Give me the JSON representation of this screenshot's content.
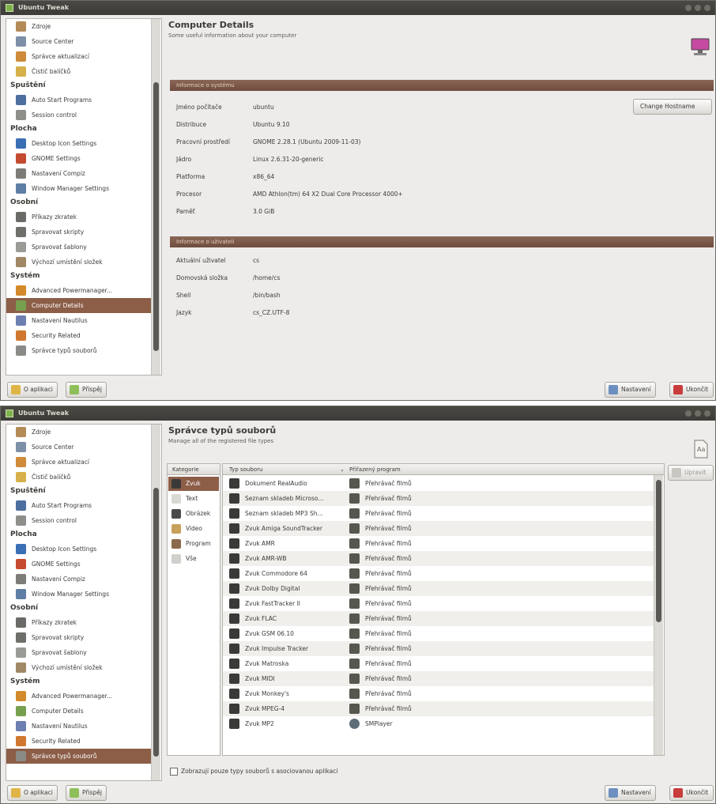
{
  "app_title": "Ubuntu Tweak",
  "colors": {
    "accent": "#8c5e48",
    "titlebar": "#3c3b37",
    "banner": "#7c5a4a",
    "window_bg": "#edeceb"
  },
  "sidebar": {
    "items": [
      {
        "label": "Zdroje",
        "icon": "folder-icon",
        "type": "item"
      },
      {
        "label": "Source Center",
        "icon": "source-icon",
        "type": "item"
      },
      {
        "label": "Správce aktualizací",
        "icon": "update-icon",
        "type": "item"
      },
      {
        "label": "Čistič balíčků",
        "icon": "broom-icon",
        "type": "item"
      },
      {
        "label": "Spuštění",
        "type": "header"
      },
      {
        "label": "Auto Start Programs",
        "icon": "autostart-icon",
        "type": "item"
      },
      {
        "label": "Session control",
        "icon": "session-icon",
        "type": "item"
      },
      {
        "label": "Plocha",
        "type": "header"
      },
      {
        "label": "Desktop Icon Settings",
        "icon": "desktop-icon",
        "type": "item"
      },
      {
        "label": "GNOME Settings",
        "icon": "gnome-icon",
        "type": "item"
      },
      {
        "label": "Nastavení Compiz",
        "icon": "compiz-icon",
        "type": "item"
      },
      {
        "label": "Window Manager Settings",
        "icon": "window-icon",
        "type": "item"
      },
      {
        "label": "Osobní",
        "type": "header"
      },
      {
        "label": "Příkazy zkratek",
        "icon": "shortcut-icon",
        "type": "item"
      },
      {
        "label": "Spravovat skripty",
        "icon": "script-icon",
        "type": "item"
      },
      {
        "label": "Spravovat šablony",
        "icon": "template-icon",
        "type": "item"
      },
      {
        "label": "Výchozí umístění složek",
        "icon": "folder-home-icon",
        "type": "item"
      },
      {
        "label": "Systém",
        "type": "header"
      },
      {
        "label": "Advanced Powermanager...",
        "icon": "power-icon",
        "type": "item"
      },
      {
        "label": "Computer Details",
        "icon": "computer-icon",
        "type": "item"
      },
      {
        "label": "Nastavení Nautilus",
        "icon": "nautilus-icon",
        "type": "item"
      },
      {
        "label": "Security Related",
        "icon": "security-icon",
        "type": "item"
      },
      {
        "label": "Správce typů souborů",
        "icon": "filetypes-icon",
        "type": "item"
      }
    ]
  },
  "footer": {
    "about_label": "O aplikaci",
    "donate_label": "Přispěj",
    "settings_label": "Nastavení",
    "quit_label": "Ukončit"
  },
  "computer_details": {
    "title": "Computer Details",
    "subtitle": "Some useful information about your computer",
    "section1": "Informace o systému",
    "hostname_button": "Change Hostname",
    "system_rows": [
      {
        "key": "Jméno počítače",
        "value": "ubuntu"
      },
      {
        "key": "Distribuce",
        "value": "Ubuntu 9.10"
      },
      {
        "key": "Pracovní prostředí",
        "value": "GNOME 2.28.1 (Ubuntu 2009-11-03)"
      },
      {
        "key": "Jádro",
        "value": "Linux 2.6.31-20-generic"
      },
      {
        "key": "Platforma",
        "value": "x86_64"
      },
      {
        "key": "Procesor",
        "value": "AMD Athlon(tm) 64 X2 Dual Core Processor 4000+"
      },
      {
        "key": "Paměť",
        "value": "3.0 GiB"
      }
    ],
    "section2": "Informace o uživateli",
    "user_rows": [
      {
        "key": "Aktuální uživatel",
        "value": "cs"
      },
      {
        "key": "Domovská složka",
        "value": "/home/cs"
      },
      {
        "key": "Shell",
        "value": "/bin/bash"
      },
      {
        "key": "Jazyk",
        "value": "cs_CZ.UTF-8"
      }
    ]
  },
  "file_types": {
    "title": "Správce typů souborů",
    "subtitle": "Manage all of the registered file types",
    "edit_button": "Upravit",
    "checkbox_label": "Zobrazují pouze typy souborů s asociovanou aplikací",
    "category_header": "Kategorie",
    "column_type": "Typ souboru",
    "column_program": "Přiřazený program",
    "categories": [
      {
        "label": "Zvuk",
        "icon": "audio-icon"
      },
      {
        "label": "Text",
        "icon": "text-icon"
      },
      {
        "label": "Obrázek",
        "icon": "image-icon"
      },
      {
        "label": "Video",
        "icon": "video-icon"
      },
      {
        "label": "Program",
        "icon": "program-icon"
      },
      {
        "label": "Vše",
        "icon": "all-icon"
      }
    ],
    "rows": [
      {
        "type": "Dokument RealAudio",
        "program": "Přehrávač filmů"
      },
      {
        "type": "Seznam skladeb Microso...",
        "program": "Přehrávač filmů"
      },
      {
        "type": "Seznam skladeb MP3 Sh...",
        "program": "Přehrávač filmů"
      },
      {
        "type": "Zvuk Amiga SoundTracker",
        "program": "Přehrávač filmů"
      },
      {
        "type": "Zvuk AMR",
        "program": "Přehrávač filmů"
      },
      {
        "type": "Zvuk AMR-WB",
        "program": "Přehrávač filmů"
      },
      {
        "type": "Zvuk Commodore 64",
        "program": "Přehrávač filmů"
      },
      {
        "type": "Zvuk Dolby Digital",
        "program": "Přehrávač filmů"
      },
      {
        "type": "Zvuk FastTracker II",
        "program": "Přehrávač filmů"
      },
      {
        "type": "Zvuk FLAC",
        "program": "Přehrávač filmů"
      },
      {
        "type": "Zvuk GSM 06.10",
        "program": "Přehrávač filmů"
      },
      {
        "type": "Zvuk Impulse Tracker",
        "program": "Přehrávač filmů"
      },
      {
        "type": "Zvuk Matroska",
        "program": "Přehrávač filmů"
      },
      {
        "type": "Zvuk MIDI",
        "program": "Přehrávač filmů"
      },
      {
        "type": "Zvuk Monkey's",
        "program": "Přehrávač filmů"
      },
      {
        "type": "Zvuk MPEG-4",
        "program": "Přehrávač filmů"
      },
      {
        "type": "Zvuk MP2",
        "program": "SMPlayer"
      }
    ]
  }
}
